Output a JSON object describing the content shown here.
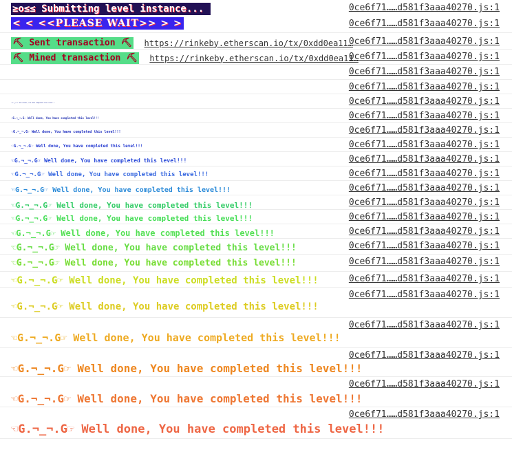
{
  "console": {
    "banner_line1": "≥o≤≤ Submitting level instance...",
    "banner_line2": "<  < <<PLEASE WAIT>> >  >",
    "sent_label": "⛏ Sent transaction ⛏",
    "sent_url": "https://rinkeby.etherscan.io/tx/0xdd0ea11…",
    "mined_label": "⛏ Mined transaction ⛏",
    "mined_url": "https://rinkeby.etherscan.io/tx/0xdd0ea11…",
    "source": "0ce6f71……d581f3aaa40270.js:1",
    "done_message": "☜G.¬_¬.G☞ Well done, You have completed this level!!!",
    "done_levels": [
      {
        "size": 1,
        "color": "#1a2a9a"
      },
      {
        "size": 2,
        "color": "#1a2a9a"
      },
      {
        "size": 4,
        "color": "#1f2fb0"
      },
      {
        "size": 5,
        "color": "#2030c0"
      },
      {
        "size": 6,
        "color": "#2238d0"
      },
      {
        "size": 8,
        "color": "#2848d8"
      },
      {
        "size": 9,
        "color": "#3a6ae0"
      },
      {
        "size": 10,
        "color": "#2a8ad8"
      },
      {
        "size": 11,
        "color": "#33cc66"
      },
      {
        "size": 11,
        "color": "#44dd55"
      },
      {
        "size": 12,
        "color": "#55e055"
      },
      {
        "size": 13,
        "color": "#66dd44"
      },
      {
        "size": 13,
        "color": "#77dd33"
      },
      {
        "size": 14,
        "color": "#ccdd22"
      },
      {
        "size": 14,
        "color": "#ddcc22"
      },
      {
        "size": 15,
        "color": "#eeaa22"
      },
      {
        "size": 16,
        "color": "#ee8822"
      },
      {
        "size": 16,
        "color": "#ee7733"
      },
      {
        "size": 17,
        "color": "#ee6644"
      }
    ]
  }
}
